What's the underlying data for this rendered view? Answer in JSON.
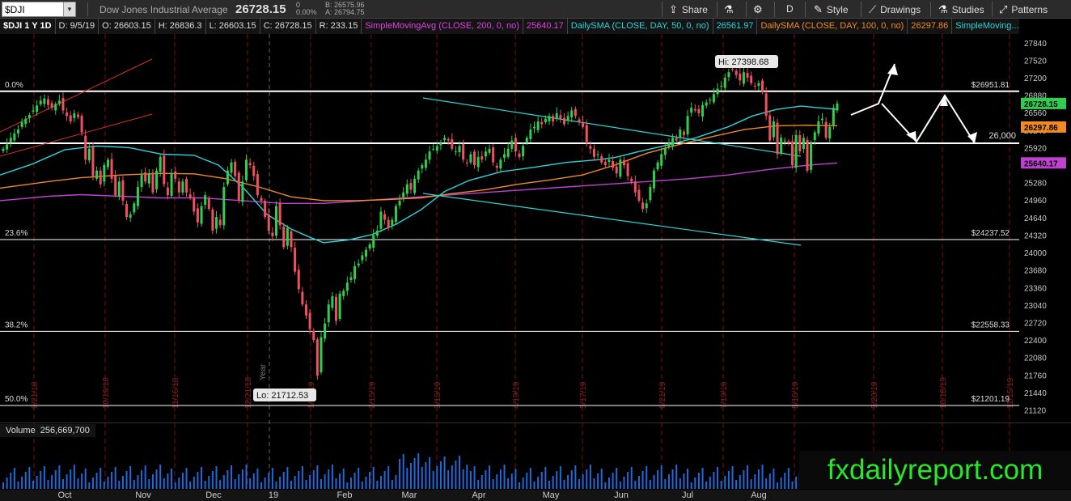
{
  "toolbar": {
    "symbol": "$DJI",
    "company": "Dow Jones Industrial Average",
    "last": "26728.15",
    "change": "0",
    "change_pct": "0.00%",
    "bid": "B: 26575.96",
    "ask": "A: 26794.75",
    "share": "Share",
    "style": "Style",
    "drawings": "Drawings",
    "studies": "Studies",
    "patterns": "Patterns",
    "aggregation": "D"
  },
  "infobar": {
    "title": "$DJI 1 Y 1D",
    "date": "D: 9/5/19",
    "open": "O: 26603.15",
    "high": "H: 26836.3",
    "low": "L: 26603.15",
    "close": "C: 26728.15",
    "range": "R: 233.15",
    "sma200_name": "SimpleMovingAvg (CLOSE, 200, 0, no)",
    "sma200_val": "25640.17",
    "sma50_name": "DailySMA (CLOSE, DAY, 50, 0, no)",
    "sma50_val": "26561.97",
    "sma100_name": "DailySMA (CLOSE, DAY, 100, 0, no)",
    "sma100_val": "26297.86",
    "more": "SimpleMoving..."
  },
  "volume": {
    "label": "Volume",
    "value": "256,669,700"
  },
  "watermark": "fxdailyreport.com",
  "colors": {
    "up": "#2ecf4f",
    "down": "#f05060",
    "sma200": "#c040d0",
    "sma50": "#2ad4d8",
    "sma100": "#f08a24",
    "trend_red": "#d8301f",
    "trend_cyan": "#2ad4d8",
    "level_line": "#ffffff"
  },
  "chart_data": {
    "type": "candlestick",
    "y_range": [
      20920,
      28000
    ],
    "price_axis_ticks": [
      21120,
      21440,
      21760,
      22080,
      22400,
      22720,
      23040,
      23360,
      23680,
      24000,
      24320,
      24640,
      24960,
      25280,
      25600,
      25920,
      26240,
      26560,
      26880,
      27200,
      27520,
      27840
    ],
    "month_labels": [
      "Oct",
      "Nov",
      "Dec",
      "19",
      "Feb",
      "Mar",
      "Apr",
      "May",
      "Jun",
      "Jul",
      "Aug"
    ],
    "vertical_date_labels": [
      "9/21/18",
      "10/19/18",
      "11/16/18",
      "12/21/18",
      "1/18/19",
      "2/15/19",
      "3/15/19",
      "4/19/19",
      "5/17/19",
      "6/21/19",
      "7/19/19",
      "8/16/19",
      "9/20/19",
      "10/18/19",
      "11/15/19"
    ],
    "fib_levels": [
      {
        "label": "0.0%",
        "price": 26951.81,
        "price_label": "$26951.81"
      },
      {
        "label": "23.6%",
        "price": 24237.52,
        "price_label": "$24237.52"
      },
      {
        "label": "38.2%",
        "price": 22558.33,
        "price_label": "$22558.33"
      },
      {
        "label": "50.0%",
        "price": 21201.19,
        "price_label": "$21201.19"
      }
    ],
    "support_level": {
      "price": 26000,
      "label": "26,000"
    },
    "hi_bubble": "Hi: 27398.68",
    "lo_bubble": "Lo: 21712.53",
    "year_marker": "Year",
    "last_price_tags": [
      {
        "text": "26728.15",
        "price": 26728.15,
        "color": "#2ecf4f"
      },
      {
        "text": "26297.86",
        "price": 26297.86,
        "color": "#f08a24"
      },
      {
        "text": "25640.17",
        "price": 25640.17,
        "color": "#c040d0"
      }
    ],
    "closes": [
      25900,
      25980,
      26100,
      26180,
      26250,
      26390,
      26450,
      26520,
      26600,
      26690,
      26780,
      26820,
      26700,
      26650,
      26720,
      26780,
      26600,
      26500,
      26400,
      26550,
      26480,
      26200,
      25700,
      25900,
      25400,
      25500,
      25250,
      25600,
      25700,
      25350,
      25050,
      25300,
      24950,
      24650,
      24700,
      24900,
      25200,
      25420,
      25300,
      25450,
      25100,
      25500,
      25750,
      25250,
      25050,
      25450,
      25350,
      25100,
      25300,
      25100,
      25000,
      24750,
      24550,
      24850,
      25050,
      24800,
      24400,
      24650,
      24500,
      25200,
      25500,
      25650,
      25400,
      24950,
      25300,
      25700,
      25600,
      25400,
      25050,
      24950,
      24650,
      24400,
      24300,
      24850,
      24500,
      24100,
      24450,
      24100,
      23650,
      23330,
      23050,
      22850,
      22600,
      22400,
      21750,
      22450,
      22700,
      23050,
      23200,
      22750,
      23250,
      23300,
      23450,
      23550,
      23750,
      23800,
      23950,
      24050,
      24150,
      24320,
      24400,
      24750,
      24600,
      24450,
      24600,
      24850,
      24950,
      25100,
      25250,
      25150,
      25350,
      25500,
      25600,
      25700,
      25850,
      25900,
      25950,
      26000,
      26100,
      26050,
      25900,
      25850,
      25950,
      25700,
      25650,
      25800,
      25600,
      25750,
      25700,
      25850,
      25900,
      25650,
      25550,
      25700,
      25800,
      25900,
      26050,
      25850,
      25750,
      25950,
      26100,
      26250,
      26300,
      26400,
      26350,
      26450,
      26500,
      26400,
      26550,
      26450,
      26350,
      26500,
      26600,
      26500,
      26400,
      26300,
      26000,
      25900,
      25750,
      25800,
      25650,
      25600,
      25700,
      25550,
      25450,
      25700,
      25600,
      25400,
      25300,
      25100,
      24950,
      24800,
      24900,
      25200,
      25500,
      25650,
      25800,
      25900,
      26000,
      26100,
      26050,
      26250,
      26150,
      26500,
      26650,
      26600,
      26550,
      26700,
      26750,
      26800,
      26900,
      27000,
      27050,
      27200,
      27300,
      27350,
      27250,
      27150,
      27300,
      27200,
      27100,
      27050,
      27100,
      26950,
      26500,
      26050,
      26400,
      25800,
      26100,
      26050,
      26000,
      25600,
      26150,
      25850,
      26100,
      25500,
      26000,
      26200,
      26400,
      26450,
      26100,
      26300,
      26650,
      26728.15
    ],
    "sma50_path": [
      [
        0,
        25420
      ],
      [
        40,
        25620
      ],
      [
        80,
        25880
      ],
      [
        120,
        25950
      ],
      [
        160,
        25920
      ],
      [
        200,
        25800
      ],
      [
        240,
        25780
      ],
      [
        270,
        25600
      ],
      [
        300,
        25200
      ],
      [
        330,
        24700
      ],
      [
        360,
        24430
      ],
      [
        380,
        24300
      ],
      [
        400,
        24180
      ],
      [
        430,
        24230
      ],
      [
        460,
        24330
      ],
      [
        490,
        24520
      ],
      [
        520,
        24780
      ],
      [
        550,
        25120
      ],
      [
        580,
        25320
      ],
      [
        620,
        25480
      ],
      [
        660,
        25560
      ],
      [
        700,
        25650
      ],
      [
        740,
        25700
      ],
      [
        760,
        25740
      ],
      [
        790,
        25850
      ],
      [
        820,
        25950
      ],
      [
        860,
        26100
      ],
      [
        900,
        26300
      ],
      [
        930,
        26500
      ],
      [
        960,
        26620
      ],
      [
        990,
        26680
      ],
      [
        1020,
        26640
      ],
      [
        1035,
        26620
      ]
    ],
    "sma100_path": [
      [
        0,
        25180
      ],
      [
        60,
        25300
      ],
      [
        100,
        25370
      ],
      [
        150,
        25420
      ],
      [
        200,
        25450
      ],
      [
        240,
        25440
      ],
      [
        280,
        25350
      ],
      [
        320,
        25200
      ],
      [
        360,
        25020
      ],
      [
        400,
        24950
      ],
      [
        440,
        24950
      ],
      [
        480,
        24970
      ],
      [
        520,
        25000
      ],
      [
        560,
        25080
      ],
      [
        600,
        25150
      ],
      [
        640,
        25250
      ],
      [
        680,
        25330
      ],
      [
        720,
        25420
      ],
      [
        760,
        25600
      ],
      [
        800,
        25820
      ],
      [
        840,
        25980
      ],
      [
        880,
        26120
      ],
      [
        920,
        26250
      ],
      [
        960,
        26320
      ],
      [
        1000,
        26330
      ],
      [
        1035,
        26320
      ]
    ],
    "sma200_path": [
      [
        0,
        24950
      ],
      [
        60,
        25030
      ],
      [
        100,
        25060
      ],
      [
        150,
        25030
      ],
      [
        200,
        25000
      ],
      [
        250,
        25000
      ],
      [
        300,
        24950
      ],
      [
        350,
        24900
      ],
      [
        400,
        24900
      ],
      [
        450,
        24950
      ],
      [
        500,
        25000
      ],
      [
        550,
        25050
      ],
      [
        600,
        25100
      ],
      [
        650,
        25150
      ],
      [
        700,
        25200
      ],
      [
        750,
        25250
      ],
      [
        800,
        25300
      ],
      [
        850,
        25350
      ],
      [
        900,
        25420
      ],
      [
        950,
        25520
      ],
      [
        1000,
        25600
      ],
      [
        1035,
        25640
      ]
    ]
  }
}
